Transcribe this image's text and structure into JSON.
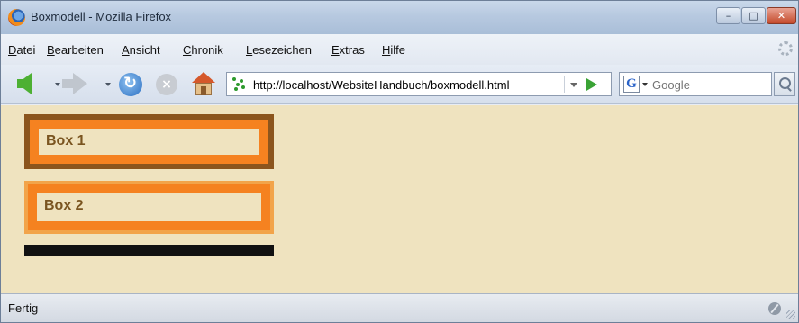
{
  "window": {
    "title": "Boxmodell - Mozilla Firefox",
    "controls": {
      "minimize": "–",
      "maximize": "□",
      "close": "✕"
    }
  },
  "menubar": {
    "items": [
      "Datei",
      "Bearbeiten",
      "Ansicht",
      "Chronik",
      "Lesezeichen",
      "Extras",
      "Hilfe"
    ]
  },
  "toolbar": {
    "url": "http://localhost/WebsiteHandbuch/boxmodell.html",
    "search_engine": "G",
    "search_placeholder": "Google",
    "icons": [
      "back-icon",
      "forward-icon",
      "reload-icon",
      "stop-icon",
      "home-icon",
      "go-icon",
      "search-icon"
    ]
  },
  "page": {
    "box1_label": "Box 1",
    "box2_label": "Box 2",
    "colors": {
      "background": "#efe3bf",
      "box1_border": "#8b551d",
      "box_padding": "#f58220",
      "box2_border": "#f2a44a",
      "text": "#7a5520",
      "black_bar": "#111111"
    }
  },
  "statusbar": {
    "text": "Fertig"
  }
}
